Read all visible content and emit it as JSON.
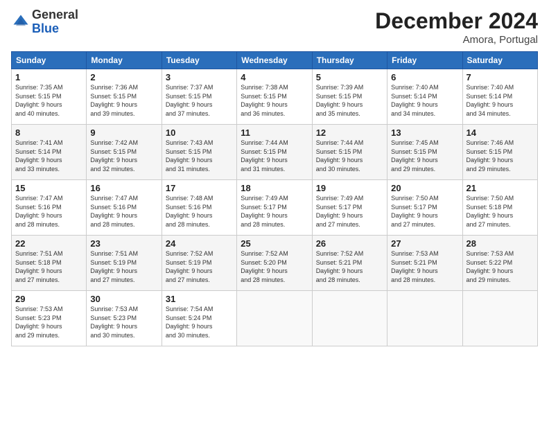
{
  "header": {
    "logo_general": "General",
    "logo_blue": "Blue",
    "month_title": "December 2024",
    "location": "Amora, Portugal"
  },
  "weekdays": [
    "Sunday",
    "Monday",
    "Tuesday",
    "Wednesday",
    "Thursday",
    "Friday",
    "Saturday"
  ],
  "weeks": [
    [
      {
        "day": "1",
        "sunrise": "7:35 AM",
        "sunset": "5:15 PM",
        "daylight": "9 hours and 40 minutes."
      },
      {
        "day": "2",
        "sunrise": "7:36 AM",
        "sunset": "5:15 PM",
        "daylight": "9 hours and 39 minutes."
      },
      {
        "day": "3",
        "sunrise": "7:37 AM",
        "sunset": "5:15 PM",
        "daylight": "9 hours and 37 minutes."
      },
      {
        "day": "4",
        "sunrise": "7:38 AM",
        "sunset": "5:15 PM",
        "daylight": "9 hours and 36 minutes."
      },
      {
        "day": "5",
        "sunrise": "7:39 AM",
        "sunset": "5:15 PM",
        "daylight": "9 hours and 35 minutes."
      },
      {
        "day": "6",
        "sunrise": "7:40 AM",
        "sunset": "5:14 PM",
        "daylight": "9 hours and 34 minutes."
      },
      {
        "day": "7",
        "sunrise": "7:40 AM",
        "sunset": "5:14 PM",
        "daylight": "9 hours and 34 minutes."
      }
    ],
    [
      {
        "day": "8",
        "sunrise": "7:41 AM",
        "sunset": "5:14 PM",
        "daylight": "9 hours and 33 minutes."
      },
      {
        "day": "9",
        "sunrise": "7:42 AM",
        "sunset": "5:15 PM",
        "daylight": "9 hours and 32 minutes."
      },
      {
        "day": "10",
        "sunrise": "7:43 AM",
        "sunset": "5:15 PM",
        "daylight": "9 hours and 31 minutes."
      },
      {
        "day": "11",
        "sunrise": "7:44 AM",
        "sunset": "5:15 PM",
        "daylight": "9 hours and 31 minutes."
      },
      {
        "day": "12",
        "sunrise": "7:44 AM",
        "sunset": "5:15 PM",
        "daylight": "9 hours and 30 minutes."
      },
      {
        "day": "13",
        "sunrise": "7:45 AM",
        "sunset": "5:15 PM",
        "daylight": "9 hours and 29 minutes."
      },
      {
        "day": "14",
        "sunrise": "7:46 AM",
        "sunset": "5:15 PM",
        "daylight": "9 hours and 29 minutes."
      }
    ],
    [
      {
        "day": "15",
        "sunrise": "7:47 AM",
        "sunset": "5:16 PM",
        "daylight": "9 hours and 28 minutes."
      },
      {
        "day": "16",
        "sunrise": "7:47 AM",
        "sunset": "5:16 PM",
        "daylight": "9 hours and 28 minutes."
      },
      {
        "day": "17",
        "sunrise": "7:48 AM",
        "sunset": "5:16 PM",
        "daylight": "9 hours and 28 minutes."
      },
      {
        "day": "18",
        "sunrise": "7:49 AM",
        "sunset": "5:17 PM",
        "daylight": "9 hours and 28 minutes."
      },
      {
        "day": "19",
        "sunrise": "7:49 AM",
        "sunset": "5:17 PM",
        "daylight": "9 hours and 27 minutes."
      },
      {
        "day": "20",
        "sunrise": "7:50 AM",
        "sunset": "5:17 PM",
        "daylight": "9 hours and 27 minutes."
      },
      {
        "day": "21",
        "sunrise": "7:50 AM",
        "sunset": "5:18 PM",
        "daylight": "9 hours and 27 minutes."
      }
    ],
    [
      {
        "day": "22",
        "sunrise": "7:51 AM",
        "sunset": "5:18 PM",
        "daylight": "9 hours and 27 minutes."
      },
      {
        "day": "23",
        "sunrise": "7:51 AM",
        "sunset": "5:19 PM",
        "daylight": "9 hours and 27 minutes."
      },
      {
        "day": "24",
        "sunrise": "7:52 AM",
        "sunset": "5:19 PM",
        "daylight": "9 hours and 27 minutes."
      },
      {
        "day": "25",
        "sunrise": "7:52 AM",
        "sunset": "5:20 PM",
        "daylight": "9 hours and 28 minutes."
      },
      {
        "day": "26",
        "sunrise": "7:52 AM",
        "sunset": "5:21 PM",
        "daylight": "9 hours and 28 minutes."
      },
      {
        "day": "27",
        "sunrise": "7:53 AM",
        "sunset": "5:21 PM",
        "daylight": "9 hours and 28 minutes."
      },
      {
        "day": "28",
        "sunrise": "7:53 AM",
        "sunset": "5:22 PM",
        "daylight": "9 hours and 29 minutes."
      }
    ],
    [
      {
        "day": "29",
        "sunrise": "7:53 AM",
        "sunset": "5:23 PM",
        "daylight": "9 hours and 29 minutes."
      },
      {
        "day": "30",
        "sunrise": "7:53 AM",
        "sunset": "5:23 PM",
        "daylight": "9 hours and 30 minutes."
      },
      {
        "day": "31",
        "sunrise": "7:54 AM",
        "sunset": "5:24 PM",
        "daylight": "9 hours and 30 minutes."
      },
      null,
      null,
      null,
      null
    ]
  ]
}
